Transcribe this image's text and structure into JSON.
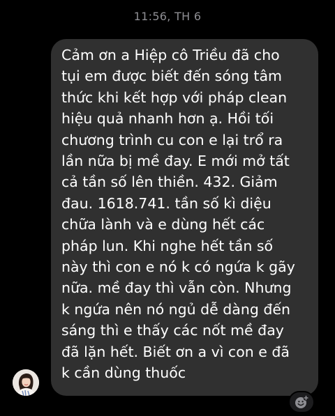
{
  "chat": {
    "timestamp": "11:56, TH 6",
    "message": {
      "lines": [
        "Cảm ơn a Hiệp cô Triều đã cho",
        "tụi em được biết đến sóng tâm",
        "thức khi kết hợp với pháp clean",
        "hiệu quả nhanh hơn ạ. Hồi tối",
        "chương trình cu con e lại trổ ra",
        "lần nữa bị mề đay. E mới mở tất",
        "cả tần số lên thiền. 432. Giảm",
        "đau. 1618.741. tần số kì diệu",
        "chữa lành và e dùng hết các",
        "pháp lun. Khi nghe hết tần số",
        "này thì con e nó k có ngứa k gãy",
        "nữa. mề đay thì vẫn còn. Nhưng",
        "k ngứa nên nó ngủ dễ dàng đến",
        "sáng thì e thấy các nốt mề đay",
        "đã lặn hết. Biết ơn a vì con e đã",
        "k cần dùng thuốc"
      ]
    },
    "sender": {
      "avatar_icon": "user-avatar"
    },
    "reaction": {
      "icon": "add-reaction-icon"
    }
  },
  "colors": {
    "background": "#000000",
    "bubble": "#303030",
    "message_text": "#ffffff",
    "timestamp_text": "#8e8e93"
  }
}
